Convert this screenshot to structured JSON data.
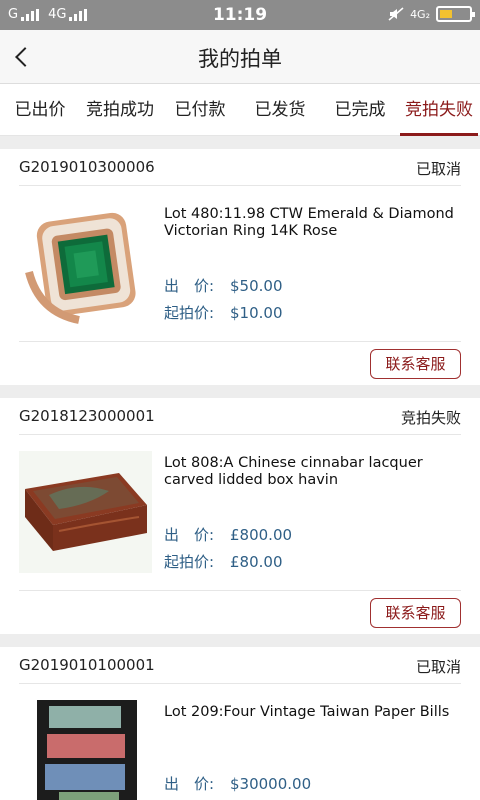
{
  "status_bar": {
    "carrier_left": "G",
    "network": "4G",
    "time": "11:19",
    "network_right": "4G₂"
  },
  "header": {
    "title": "我的拍单"
  },
  "tabs": [
    {
      "label": "已出价",
      "active": false
    },
    {
      "label": "竞拍成功",
      "active": false
    },
    {
      "label": "已付款",
      "active": false
    },
    {
      "label": "已发货",
      "active": false
    },
    {
      "label": "已完成",
      "active": false
    },
    {
      "label": "竞拍失败",
      "active": true
    }
  ],
  "orders": [
    {
      "order_no": "G2019010300006",
      "status": "已取消",
      "lot_title": "Lot 480:11.98 CTW Emerald & Diamond Victorian Ring 14K Rose",
      "bid_label": "出　价:",
      "bid_value": "$50.00",
      "start_label": "起拍价:",
      "start_value": "$10.00",
      "button": "联系客服"
    },
    {
      "order_no": "G2018123000001",
      "status": "竞拍失败",
      "lot_title": "Lot 808:A Chinese cinnabar lacquer carved lidded box havin",
      "bid_label": "出　价:",
      "bid_value": "£800.00",
      "start_label": "起拍价:",
      "start_value": "£80.00",
      "button": "联系客服"
    },
    {
      "order_no": "G2019010100001",
      "status": "已取消",
      "lot_title": "Lot 209:Four Vintage Taiwan Paper Bills",
      "bid_label": "出　价:",
      "bid_value": "$30000.00"
    }
  ],
  "colors": {
    "accent": "#8b1a1a",
    "price": "#2f5f86",
    "status_bar": "#8c8c8c"
  }
}
